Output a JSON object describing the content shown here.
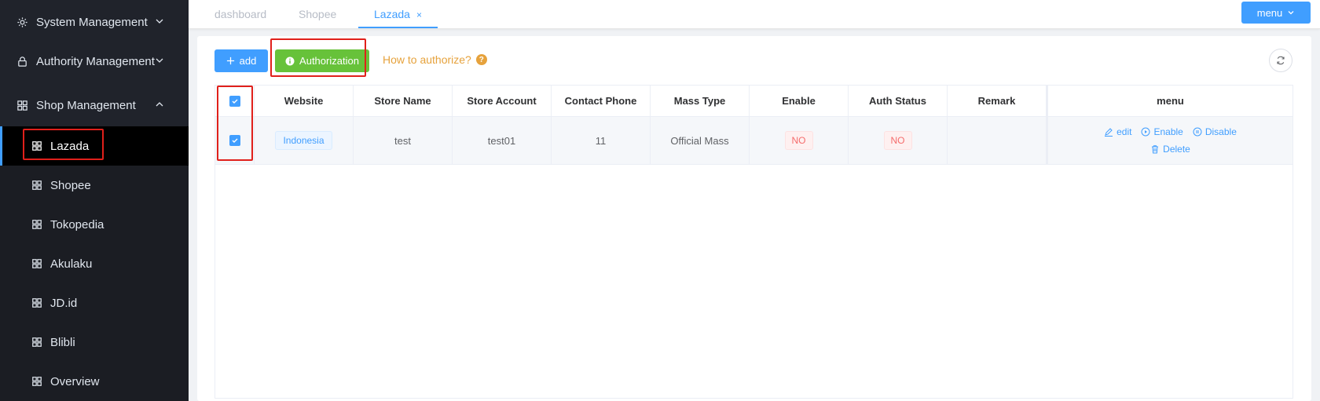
{
  "sidebar": {
    "groups": [
      {
        "label": "System Management",
        "icon": "gear-icon"
      },
      {
        "label": "Authority Management",
        "icon": "lock-icon"
      },
      {
        "label": "Shop Management",
        "icon": "grid-icon"
      }
    ],
    "items": [
      {
        "label": "Lazada"
      },
      {
        "label": "Shopee"
      },
      {
        "label": "Tokopedia"
      },
      {
        "label": "Akulaku"
      },
      {
        "label": "JD.id"
      },
      {
        "label": "Blibli"
      },
      {
        "label": "Overview"
      }
    ]
  },
  "tabs": [
    {
      "label": "dashboard"
    },
    {
      "label": "Shopee"
    },
    {
      "label": "Lazada",
      "close": "×"
    }
  ],
  "header": {
    "menu_label": "menu"
  },
  "toolbar": {
    "add_label": "add",
    "auth_label": "Authorization",
    "how_label": "How to authorize?",
    "how_icon": "?"
  },
  "table": {
    "columns": [
      "Website",
      "Store Name",
      "Store Account",
      "Contact Phone",
      "Mass Type",
      "Enable",
      "Auth Status",
      "Remark",
      "menu"
    ],
    "row": {
      "website": "Indonesia",
      "store_name": "test",
      "store_account": "test01",
      "contact_phone": "11",
      "mass_type": "Official Mass",
      "enable": "NO",
      "auth_status": "NO",
      "remark": "",
      "ops": {
        "edit": "edit",
        "enable": "Enable",
        "disable": "Disable",
        "delete": "Delete"
      }
    }
  },
  "colors": {
    "primary": "#409eff",
    "success": "#67c23a",
    "warning": "#e6a23c",
    "danger": "#f56c6c",
    "sidebar": "#20232b"
  }
}
